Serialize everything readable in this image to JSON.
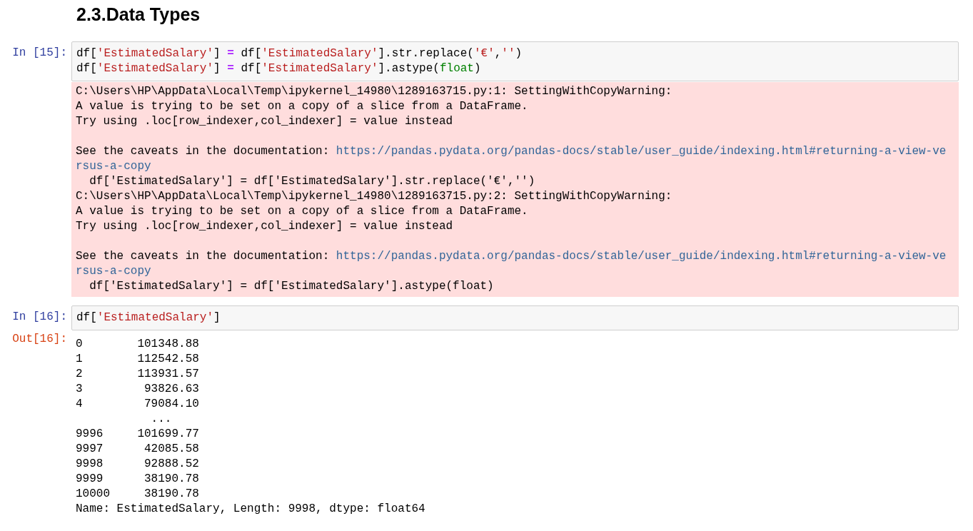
{
  "heading": "2.3.Data Types",
  "cells": [
    {
      "prompt": "In [15]:",
      "code": [
        [
          {
            "kind": "plain",
            "text": "df["
          },
          {
            "kind": "string",
            "text": "'EstimatedSalary'"
          },
          {
            "kind": "plain",
            "text": "] "
          },
          {
            "kind": "operator",
            "text": "="
          },
          {
            "kind": "plain",
            "text": " df["
          },
          {
            "kind": "string",
            "text": "'EstimatedSalary'"
          },
          {
            "kind": "plain",
            "text": "].str.replace("
          },
          {
            "kind": "string",
            "text": "'€'"
          },
          {
            "kind": "plain",
            "text": ","
          },
          {
            "kind": "string",
            "text": "''"
          },
          {
            "kind": "plain",
            "text": ")"
          }
        ],
        [
          {
            "kind": "plain",
            "text": "df["
          },
          {
            "kind": "string",
            "text": "'EstimatedSalary'"
          },
          {
            "kind": "plain",
            "text": "] "
          },
          {
            "kind": "operator",
            "text": "="
          },
          {
            "kind": "plain",
            "text": " df["
          },
          {
            "kind": "string",
            "text": "'EstimatedSalary'"
          },
          {
            "kind": "plain",
            "text": "].astype("
          },
          {
            "kind": "builtin",
            "text": "float"
          },
          {
            "kind": "plain",
            "text": ")"
          }
        ]
      ],
      "output": {
        "kind": "stderr",
        "lines": [
          {
            "kind": "text",
            "text": "C:\\Users\\HP\\AppData\\Local\\Temp\\ipykernel_14980\\1289163715.py:1: SettingWithCopyWarning:"
          },
          {
            "kind": "text",
            "text": "A value is trying to be set on a copy of a slice from a DataFrame."
          },
          {
            "kind": "text",
            "text": "Try using .loc[row_indexer,col_indexer] = value instead"
          },
          {
            "kind": "blank"
          },
          {
            "kind": "text",
            "text": "See the caveats in the documentation: ",
            "link": "https://pandas.pydata.org/pandas-docs/stable/user_guide/indexing.html#returning-a-view-ve"
          },
          {
            "kind": "link",
            "link": "rsus-a-copy"
          },
          {
            "kind": "text",
            "text": "  df['EstimatedSalary'] = df['EstimatedSalary'].str.replace('€','')"
          },
          {
            "kind": "text",
            "text": "C:\\Users\\HP\\AppData\\Local\\Temp\\ipykernel_14980\\1289163715.py:2: SettingWithCopyWarning:"
          },
          {
            "kind": "text",
            "text": "A value is trying to be set on a copy of a slice from a DataFrame."
          },
          {
            "kind": "text",
            "text": "Try using .loc[row_indexer,col_indexer] = value instead"
          },
          {
            "kind": "blank"
          },
          {
            "kind": "text",
            "text": "See the caveats in the documentation: ",
            "link": "https://pandas.pydata.org/pandas-docs/stable/user_guide/indexing.html#returning-a-view-ve"
          },
          {
            "kind": "link",
            "link": "rsus-a-copy"
          },
          {
            "kind": "text",
            "text": "  df['EstimatedSalary'] = df['EstimatedSalary'].astype(float)"
          }
        ]
      }
    },
    {
      "prompt": "In [16]:",
      "code": [
        [
          {
            "kind": "plain",
            "text": "df["
          },
          {
            "kind": "string",
            "text": "'EstimatedSalary'"
          },
          {
            "kind": "plain",
            "text": "]"
          }
        ]
      ],
      "output": {
        "kind": "result",
        "prompt": "Out[16]:",
        "lines": [
          {
            "kind": "text",
            "text": "0        101348.88"
          },
          {
            "kind": "text",
            "text": "1        112542.58"
          },
          {
            "kind": "text",
            "text": "2        113931.57"
          },
          {
            "kind": "text",
            "text": "3         93826.63"
          },
          {
            "kind": "text",
            "text": "4         79084.10"
          },
          {
            "kind": "text",
            "text": "           ..."
          },
          {
            "kind": "text",
            "text": "9996     101699.77"
          },
          {
            "kind": "text",
            "text": "9997      42085.58"
          },
          {
            "kind": "text",
            "text": "9998      92888.52"
          },
          {
            "kind": "text",
            "text": "9999      38190.78"
          },
          {
            "kind": "text",
            "text": "10000     38190.78"
          },
          {
            "kind": "text",
            "text": "Name: EstimatedSalary, Length: 9998, dtype: float64"
          }
        ]
      }
    }
  ]
}
